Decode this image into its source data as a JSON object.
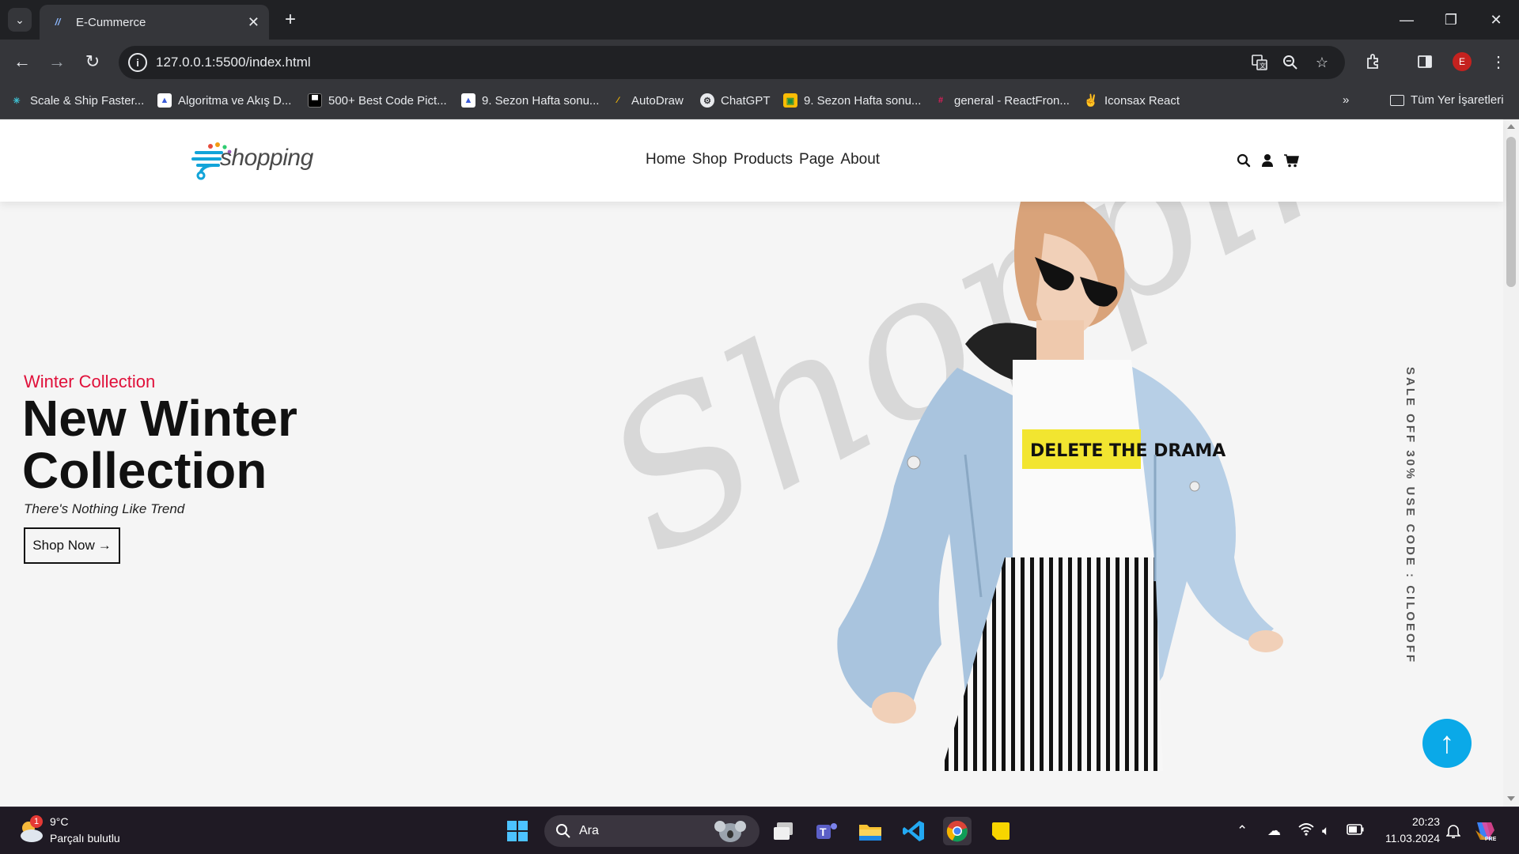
{
  "browser": {
    "tab_title": "E-Cummerce",
    "url": "127.0.0.1:5500/index.html",
    "profile_initial": "E",
    "bookmarks": [
      "Scale & Ship Faster...",
      "Algoritma ve Akış D...",
      "500+ Best Code Pict...",
      "9. Sezon Hafta sonu...",
      "AutoDraw",
      "ChatGPT",
      "9. Sezon Hafta sonu...",
      "general - ReactFron...",
      "Iconsax React"
    ],
    "all_bookmarks_label": "Tüm Yer İşaretleri"
  },
  "site": {
    "logo_text": "shopping",
    "nav": [
      "Home",
      "Shop",
      "Products",
      "Page",
      "About"
    ],
    "hero": {
      "subtitle": "Winter Collection",
      "title": "New Winter Collection",
      "tagline": "There's Nothing Like Trend",
      "cta_label": "Shop Now",
      "cta_arrow": "→",
      "watermark": "Shopping",
      "shirt_text": "DELETE THE DRAMA",
      "vertical_promo": "SALE OFF 30% USE CODE : CILOEOFF"
    },
    "back_to_top": "↑"
  },
  "taskbar": {
    "weather_temp": "9°C",
    "weather_desc": "Parçalı bulutlu",
    "weather_badge": "1",
    "search_label": "Ara",
    "time": "20:23",
    "date": "11.03.2024"
  },
  "colors": {
    "accent_red": "#e0103a",
    "accent_blue": "#0aa9e8",
    "hero_bg": "#f5f5f5"
  }
}
